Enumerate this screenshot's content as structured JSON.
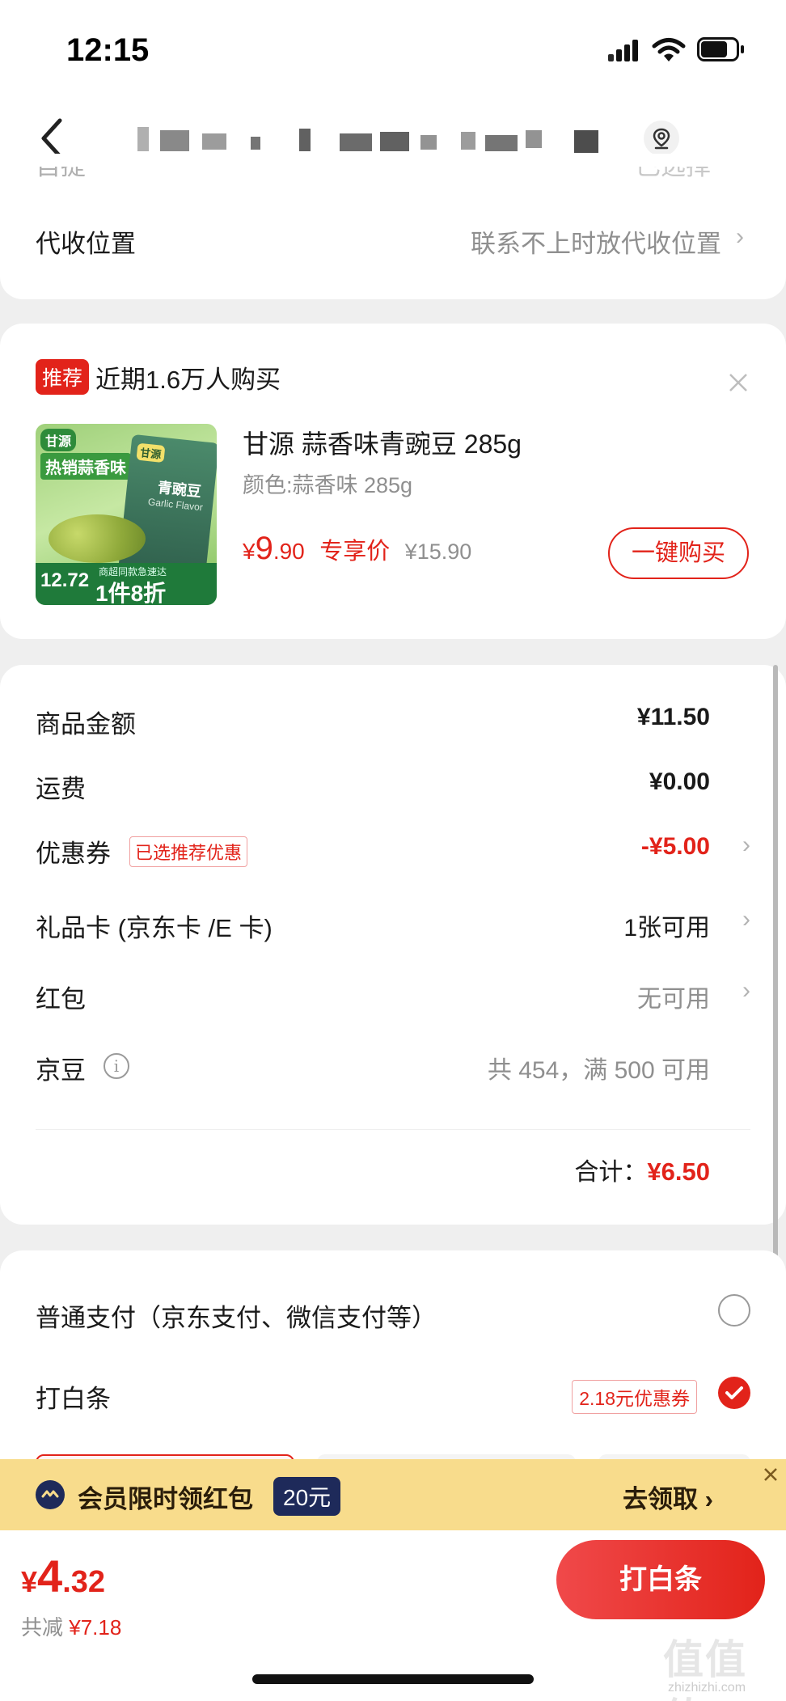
{
  "status_bar": {
    "time": "12:15"
  },
  "nav": {
    "back_icon": "chevron-left-icon",
    "location_icon": "location-icon"
  },
  "address_card": {
    "partial_row_left": "自提",
    "partial_row_right": "已选择",
    "collect_label": "代收位置",
    "collect_value": "联系不上时放代收位置"
  },
  "recommend_card": {
    "tag": "推荐",
    "headline": "近期1.6万人购买",
    "product": {
      "name": "甘源 蒜香味青豌豆 285g",
      "spec": "颜色:蒜香味 285g",
      "price_symbol": "¥",
      "price_int": "9",
      "price_dec": ".90",
      "price_tag": "专享价",
      "original_price": "¥15.90",
      "image": {
        "brand": "甘源",
        "flavor_banner": "热销蒜香味",
        "bag_brand": "甘源",
        "bag_title": "青豌豆",
        "bag_en": "Garlic Flavor",
        "price_small": "12.72",
        "deal": "1件8折",
        "deal_sub": "商超同款急速达"
      }
    },
    "buy_button": "一键购买"
  },
  "summary_card": {
    "rows": [
      {
        "label": "商品金额",
        "value": "¥11.50"
      },
      {
        "label": "运费",
        "value": "¥0.00"
      },
      {
        "label": "优惠券",
        "badge": "已选推荐优惠",
        "value": "-¥5.00"
      },
      {
        "label": "礼品卡 (京东卡 /E 卡)",
        "value": "1张可用"
      },
      {
        "label": "红包",
        "value": "无可用"
      },
      {
        "label": "京豆",
        "value": "共 454，满 500 可用"
      }
    ],
    "total_label": "合计：",
    "total_value": "¥6.50"
  },
  "payment_card": {
    "normal_pay": "普通支付（京东支付、微信支付等）",
    "baitiao": "打白条",
    "baitiao_coupon": "2.18元优惠券"
  },
  "promo_bar": {
    "text": "会员限时领红包",
    "amount": "20元",
    "action": "去领取 ›"
  },
  "bottom_bar": {
    "price_symbol": "¥",
    "price_int": "4",
    "price_dec": ".32",
    "saved_label": "共减",
    "saved_value": "¥7.18",
    "submit_button": "打白条"
  },
  "watermark": {
    "text": "值值值",
    "sub": "zhizhizhi.com"
  },
  "colors": {
    "accent_red": "#e2231a",
    "promo_bg": "#f8dc8c",
    "badge_navy": "#1e2a5a"
  }
}
